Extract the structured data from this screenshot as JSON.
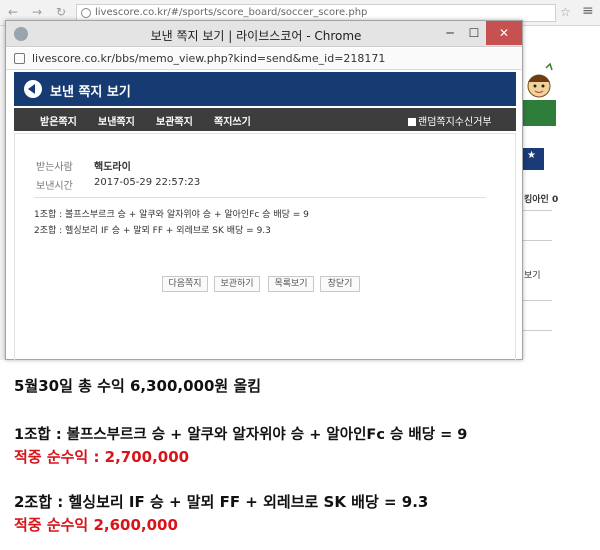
{
  "background_browser": {
    "url": "livescore.co.kr/#/sports/score_board/soccer_score.php",
    "side_texts": [
      "킹아인 0",
      "보기"
    ]
  },
  "popup": {
    "window_title": "보낸 쪽지 보기 | 라이브스코어 - Chrome",
    "url": "livescore.co.kr/bbs/memo_view.php?kind=send&me_id=218171",
    "header_title": "보낸 쪽지 보기",
    "tabs": [
      "받은쪽지",
      "보낸쪽지",
      "보관쪽지",
      "쪽지쓰기"
    ],
    "random_refuse_label": "랜덤쪽지수신거부",
    "recipient_label": "받는사람",
    "recipient_value": "핵도라이",
    "sent_time_label": "보낸시간",
    "sent_time_value": "2017-05-29 22:57:23",
    "memo_lines": [
      "1조합 : 볼프스부르크 승 + 알쿠와 알자위야 승 + 알아인Fc 승 배당 = 9",
      "2조합 : 헬싱보리 IF 승 +  말뫼 FF + 외레브로 SK 배당 = 9.3"
    ],
    "buttons": [
      "다음쪽지",
      "보관하기",
      "목록보기",
      "창닫기"
    ]
  },
  "caption": {
    "summary": "5월30일 총 수익 6,300,000원  올킴",
    "combo1": "1조합 : 볼프스부르크 승 + 알쿠와 알자위야 승 + 알아인Fc 승 배당 = 9",
    "combo1_profit": "적중 순수익 : 2,700,000",
    "combo2": "2조합 : 헬싱보리 IF 승 +  말뫼 FF + 외레브로 SK 배당 = 9.3",
    "combo2_profit": "적중 순수익 2,600,000"
  },
  "colors": {
    "header_blue": "#163a72",
    "tab_dark": "#3d3d3d",
    "profit_red": "#d8141a"
  }
}
